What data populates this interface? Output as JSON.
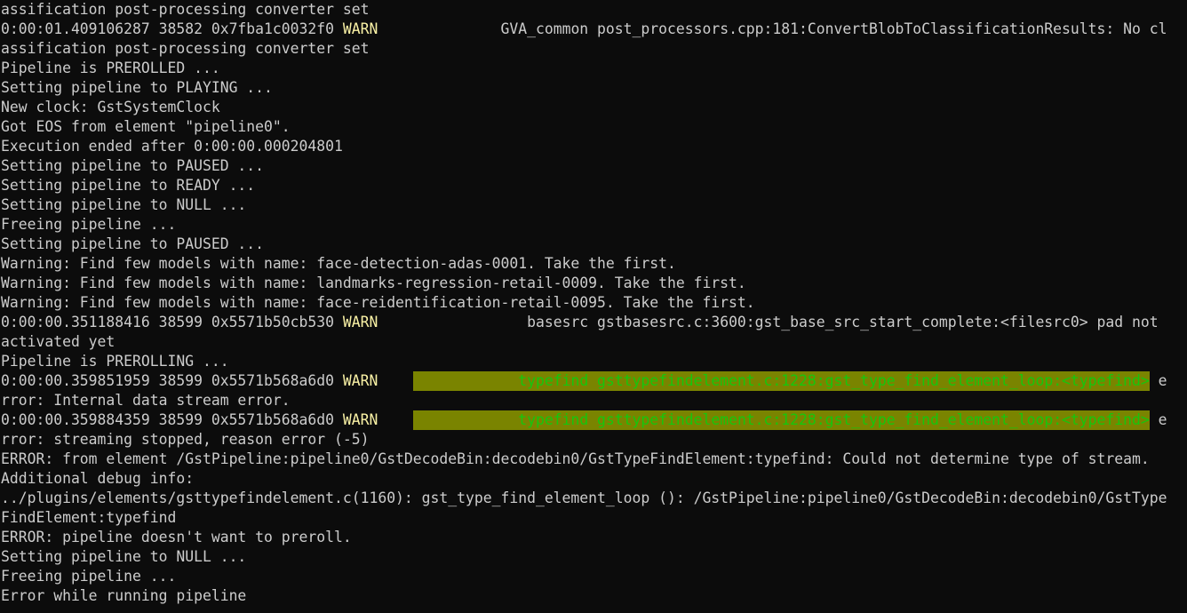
{
  "terminal": {
    "lines": [
      [
        {
          "t": "assification post-processing converter set"
        }
      ],
      [
        {
          "t": "0:00:01.409106287 38582 0x7fba1c0032f0 "
        },
        {
          "t": "WARN",
          "c": "warn"
        },
        {
          "t": "              GVA_common post_processors.cpp:181:ConvertBlobToClassificationResults: No cl"
        }
      ],
      [
        {
          "t": "assification post-processing converter set"
        }
      ],
      [
        {
          "t": "Pipeline is PREROLLED ..."
        }
      ],
      [
        {
          "t": "Setting pipeline to PLAYING ..."
        }
      ],
      [
        {
          "t": "New clock: GstSystemClock"
        }
      ],
      [
        {
          "t": "Got EOS from element \"pipeline0\"."
        }
      ],
      [
        {
          "t": "Execution ended after 0:00:00.000204801"
        }
      ],
      [
        {
          "t": "Setting pipeline to PAUSED ..."
        }
      ],
      [
        {
          "t": "Setting pipeline to READY ..."
        }
      ],
      [
        {
          "t": "Setting pipeline to NULL ..."
        }
      ],
      [
        {
          "t": "Freeing pipeline ..."
        }
      ],
      [
        {
          "t": "Setting pipeline to PAUSED ..."
        }
      ],
      [
        {
          "t": "Warning: Find few models with name: face-detection-adas-0001. Take the first."
        }
      ],
      [
        {
          "t": "Warning: Find few models with name: landmarks-regression-retail-0009. Take the first."
        }
      ],
      [
        {
          "t": "Warning: Find few models with name: face-reidentification-retail-0095. Take the first."
        }
      ],
      [
        {
          "t": "0:00:00.351188416 38599 0x5571b50cb530 "
        },
        {
          "t": "WARN",
          "c": "warn"
        },
        {
          "t": "                 basesrc gstbasesrc.c:3600:gst_base_src_start_complete:<filesrc0> pad not"
        }
      ],
      [
        {
          "t": "activated yet"
        }
      ],
      [
        {
          "t": "Pipeline is PREROLLING ..."
        }
      ],
      [
        {
          "t": "0:00:00.359851959 38599 0x5571b568a6d0 "
        },
        {
          "t": "WARN",
          "c": "warn"
        },
        {
          "t": "    "
        },
        {
          "t": "            typefind gsttypefindelement.c:1228:gst_type_find_element_loop:<typefind>",
          "c": "hl"
        },
        {
          "t": " e"
        }
      ],
      [
        {
          "t": "rror: Internal data stream error."
        }
      ],
      [
        {
          "t": "0:00:00.359884359 38599 0x5571b568a6d0 "
        },
        {
          "t": "WARN",
          "c": "warn"
        },
        {
          "t": "    "
        },
        {
          "t": "            typefind gsttypefindelement.c:1228:gst_type_find_element_loop:<typefind>",
          "c": "hl"
        },
        {
          "t": " e"
        }
      ],
      [
        {
          "t": "rror: streaming stopped, reason error (-5)"
        }
      ],
      [
        {
          "t": "ERROR: from element /GstPipeline:pipeline0/GstDecodeBin:decodebin0/GstTypeFindElement:typefind: Could not determine type of stream."
        }
      ],
      [
        {
          "t": "Additional debug info:"
        }
      ],
      [
        {
          "t": "../plugins/elements/gsttypefindelement.c(1160): gst_type_find_element_loop (): /GstPipeline:pipeline0/GstDecodeBin:decodebin0/GstType"
        }
      ],
      [
        {
          "t": "FindElement:typefind"
        }
      ],
      [
        {
          "t": "ERROR: pipeline doesn't want to preroll."
        }
      ],
      [
        {
          "t": "Setting pipeline to NULL ..."
        }
      ],
      [
        {
          "t": "Freeing pipeline ..."
        }
      ],
      [
        {
          "t": "Error while running pipeline"
        }
      ]
    ],
    "colors": {
      "background": "#0c0c0c",
      "text": "#cccccc",
      "warn": "#f9f1a5",
      "highlight_bg": "#7a8400",
      "highlight_text": "#16c60c"
    }
  }
}
